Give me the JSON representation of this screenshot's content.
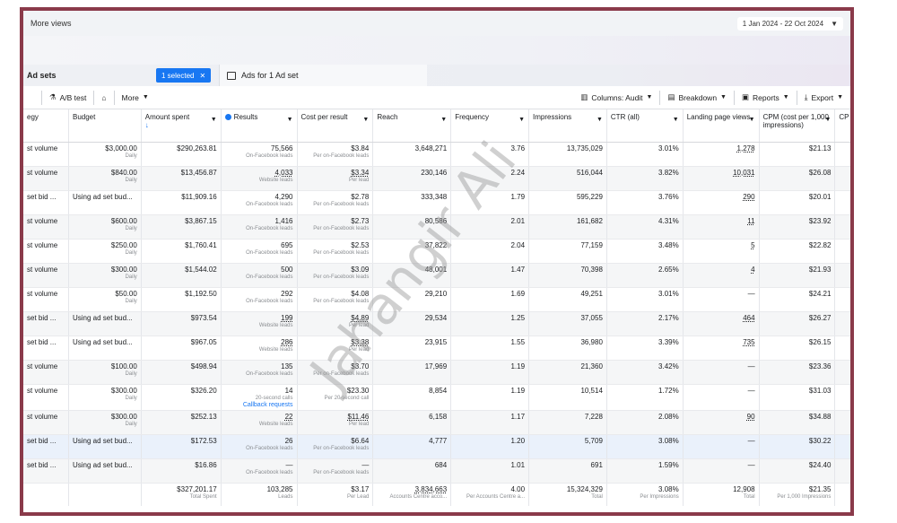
{
  "header": {
    "title": "More views",
    "date_range": "1 Jan 2024 - 22 Oct 2024"
  },
  "tabs": {
    "adsets_label": "Ad sets",
    "selected_label": "1 selected",
    "ads_label": "Ads for 1 Ad set"
  },
  "toolbar": {
    "ab_test": "A/B test",
    "more": "More",
    "columns": "Columns: Audit",
    "breakdown": "Breakdown",
    "reports": "Reports",
    "export": "Export"
  },
  "columns": [
    "egy",
    "Budget",
    "Amount spent",
    "Results",
    "Cost per result",
    "Reach",
    "Frequency",
    "Impressions",
    "CTR (all)",
    "Landing page views",
    "CPM (cost per 1,000 impressions)",
    "CP"
  ],
  "rows": [
    {
      "strategy": "st volume",
      "budget": "$3,000.00",
      "budget_sub": "Daily",
      "spent": "$290,263.81",
      "results": "75,566",
      "results_sub": "On-Facebook leads",
      "cpr": "$3.84",
      "cpr_sub": "Per on-Facebook leads",
      "reach": "3,648,271",
      "freq": "3.76",
      "impr": "13,735,029",
      "ctr": "3.01%",
      "lpv": "1,278",
      "cpm": "$21.13"
    },
    {
      "strategy": "st volume",
      "budget": "$840.00",
      "budget_sub": "Daily",
      "spent": "$13,456.87",
      "results": "4,033",
      "results_sub": "Website leads",
      "cpr": "$3.34",
      "cpr_sub": "Per lead",
      "reach": "230,146",
      "freq": "2.24",
      "impr": "516,044",
      "ctr": "3.82%",
      "lpv": "10,031",
      "cpm": "$26.08"
    },
    {
      "strategy": "set bid ...",
      "budget": "Using ad set bud...",
      "budget_sub": "",
      "spent": "$11,909.16",
      "results": "4,290",
      "results_sub": "On-Facebook leads",
      "cpr": "$2.78",
      "cpr_sub": "Per on-Facebook leads",
      "reach": "333,348",
      "freq": "1.79",
      "impr": "595,229",
      "ctr": "3.76%",
      "lpv": "290",
      "cpm": "$20.01"
    },
    {
      "strategy": "st volume",
      "budget": "$600.00",
      "budget_sub": "Daily",
      "spent": "$3,867.15",
      "results": "1,416",
      "results_sub": "On-Facebook leads",
      "cpr": "$2.73",
      "cpr_sub": "Per on-Facebook leads",
      "reach": "80,586",
      "freq": "2.01",
      "impr": "161,682",
      "ctr": "4.31%",
      "lpv": "11",
      "cpm": "$23.92"
    },
    {
      "strategy": "st volume",
      "budget": "$250.00",
      "budget_sub": "Daily",
      "spent": "$1,760.41",
      "results": "695",
      "results_sub": "On-Facebook leads",
      "cpr": "$2.53",
      "cpr_sub": "Per on-Facebook leads",
      "reach": "37,822",
      "freq": "2.04",
      "impr": "77,159",
      "ctr": "3.48%",
      "lpv": "5",
      "cpm": "$22.82"
    },
    {
      "strategy": "st volume",
      "budget": "$300.00",
      "budget_sub": "Daily",
      "spent": "$1,544.02",
      "results": "500",
      "results_sub": "On-Facebook leads",
      "cpr": "$3.09",
      "cpr_sub": "Per on-Facebook leads",
      "reach": "48,001",
      "freq": "1.47",
      "impr": "70,398",
      "ctr": "2.65%",
      "lpv": "4",
      "cpm": "$21.93"
    },
    {
      "strategy": "st volume",
      "budget": "$50.00",
      "budget_sub": "Daily",
      "spent": "$1,192.50",
      "results": "292",
      "results_sub": "On-Facebook leads",
      "cpr": "$4.08",
      "cpr_sub": "Per on-Facebook leads",
      "reach": "29,210",
      "freq": "1.69",
      "impr": "49,251",
      "ctr": "3.01%",
      "lpv": "—",
      "cpm": "$24.21"
    },
    {
      "strategy": "set bid ...",
      "budget": "Using ad set bud...",
      "budget_sub": "",
      "spent": "$973.54",
      "results": "199",
      "results_sub": "Website leads",
      "cpr": "$4.89",
      "cpr_sub": "Per lead",
      "reach": "29,534",
      "freq": "1.25",
      "impr": "37,055",
      "ctr": "2.17%",
      "lpv": "464",
      "cpm": "$26.27"
    },
    {
      "strategy": "set bid ...",
      "budget": "Using ad set bud...",
      "budget_sub": "",
      "spent": "$967.05",
      "results": "286",
      "results_sub": "Website leads",
      "cpr": "$3.38",
      "cpr_sub": "Per lead",
      "reach": "23,915",
      "freq": "1.55",
      "impr": "36,980",
      "ctr": "3.39%",
      "lpv": "735",
      "cpm": "$26.15"
    },
    {
      "strategy": "st volume",
      "budget": "$100.00",
      "budget_sub": "Daily",
      "spent": "$498.94",
      "results": "135",
      "results_sub": "On-Facebook leads",
      "cpr": "$3.70",
      "cpr_sub": "Per on-Facebook leads",
      "reach": "17,969",
      "freq": "1.19",
      "impr": "21,360",
      "ctr": "3.42%",
      "lpv": "—",
      "cpm": "$23.36"
    },
    {
      "strategy": "st volume",
      "budget": "$300.00",
      "budget_sub": "Daily",
      "spent": "$326.20",
      "results": "14",
      "results_sub": "20-second calls",
      "results_extra": "Callback requests",
      "cpr": "$23.30",
      "cpr_sub": "Per 20-second call",
      "reach": "8,854",
      "freq": "1.19",
      "impr": "10,514",
      "ctr": "1.72%",
      "lpv": "—",
      "cpm": "$31.03"
    },
    {
      "strategy": "st volume",
      "budget": "$300.00",
      "budget_sub": "Daily",
      "spent": "$252.13",
      "results": "22",
      "results_sub": "Website leads",
      "cpr": "$11.46",
      "cpr_sub": "Per lead",
      "reach": "6,158",
      "freq": "1.17",
      "impr": "7,228",
      "ctr": "2.08%",
      "lpv": "90",
      "cpm": "$34.88"
    },
    {
      "strategy": "set bid ...",
      "budget": "Using ad set bud...",
      "budget_sub": "",
      "spent": "$172.53",
      "results": "26",
      "results_sub": "On-Facebook leads",
      "cpr": "$6.64",
      "cpr_sub": "Per on-Facebook leads",
      "reach": "4,777",
      "freq": "1.20",
      "impr": "5,709",
      "ctr": "3.08%",
      "lpv": "—",
      "cpm": "$30.22"
    },
    {
      "strategy": "set bid ...",
      "budget": "Using ad set bud...",
      "budget_sub": "",
      "spent": "$16.86",
      "results": "—",
      "results_sub": "On-Facebook leads",
      "cpr": "—",
      "cpr_sub": "Per on-Facebook leads",
      "reach": "684",
      "freq": "1.01",
      "impr": "691",
      "ctr": "1.59%",
      "lpv": "—",
      "cpm": "$24.40"
    }
  ],
  "totals": {
    "spent": "$327,201.17",
    "spent_sub": "Total Spent",
    "results": "103,285",
    "results_sub": "Leads",
    "cpr": "$3.17",
    "cpr_sub": "Per Lead",
    "reach": "3,834,663",
    "reach_sub": "Accounts Centre acco...",
    "freq": "4.00",
    "freq_sub": "Per Accounts Centre a...",
    "impr": "15,324,329",
    "impr_sub": "Total",
    "ctr": "3.08%",
    "ctr_sub": "Per Impressions",
    "lpv": "12,908",
    "lpv_sub": "Total",
    "cpm": "$21.35",
    "cpm_sub": "Per 1,000 Impressions"
  },
  "watermark": "Jahangir Ali",
  "colors": {
    "accent": "#1877f2",
    "frame": "#8a3a4a"
  }
}
